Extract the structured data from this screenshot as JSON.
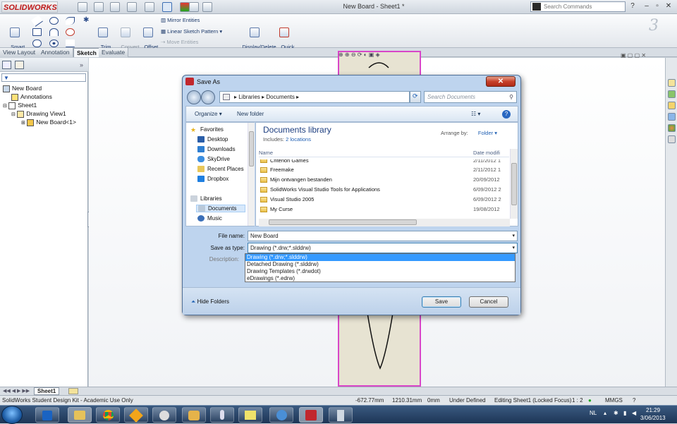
{
  "app": {
    "logo": "SOLIDWORKS",
    "document_title": "New Board - Sheet1 *",
    "search_placeholder": "Search Commands",
    "help": "?"
  },
  "commands": {
    "smart_dimension": "Smart\nDimension",
    "trim": "Trim\nEntities",
    "convert": "Convert\nEntities",
    "offset": "Offset\nEntities",
    "mirror": "Mirror Entities",
    "linear_pattern": "Linear Sketch Pattern",
    "move": "Move Entities",
    "display_delete": "Display/Delete\nRelations",
    "quick_snaps": "Quick\nSnaps"
  },
  "tabs": [
    "View Layout",
    "Annotation",
    "Sketch",
    "Evaluate"
  ],
  "active_tab": "Sketch",
  "tree": {
    "root": "New Board",
    "annotations": "Annotations",
    "sheet": "Sheet1",
    "drawing_view": "Drawing View1",
    "component": "New Board<1>"
  },
  "sheet_tab": "Sheet1",
  "status": {
    "product": "SolidWorks Student Design Kit - Academic Use Only",
    "x": "-672.77mm",
    "y": "1210.31mm",
    "z": "0mm",
    "state": "Under Defined",
    "editing": "Editing Sheet1 (Locked Focus)",
    "scale": "1 : 2",
    "units": "MMGS"
  },
  "dialog": {
    "title": "Save As",
    "address": [
      "Libraries",
      "Documents"
    ],
    "search_placeholder": "Search Documents",
    "organize": "Organize",
    "new_folder": "New folder",
    "nav": {
      "favorites": "Favorites",
      "items": [
        "Desktop",
        "Downloads",
        "SkyDrive",
        "Recent Places",
        "Dropbox"
      ],
      "libraries": "Libraries",
      "lib_items": [
        "Documents",
        "Music"
      ]
    },
    "library_title": "Documents library",
    "includes_label": "Includes:",
    "includes_link": "2 locations",
    "arrange_label": "Arrange by:",
    "arrange_value": "Folder",
    "col_name": "Name",
    "col_date": "Date modifi",
    "files": [
      {
        "name": "Criterion Games",
        "date": "2/11/2012 1"
      },
      {
        "name": "Freemake",
        "date": "2/11/2012 1"
      },
      {
        "name": "Mijn ontvangen bestanden",
        "date": "20/09/2012"
      },
      {
        "name": "SolidWorks Visual Studio Tools for Applications",
        "date": "6/09/2012 2"
      },
      {
        "name": "Visual Studio 2005",
        "date": "6/09/2012 2"
      },
      {
        "name": "My Curse",
        "date": "19/08/2012"
      }
    ],
    "file_name_label": "File name:",
    "file_name_value": "New Board",
    "save_type_label": "Save as type:",
    "save_type_value": "Drawing (*.drw;*.slddrw)",
    "type_options": [
      "Drawing (*.drw;*.slddrw)",
      "Detached Drawing (*.slddrw)",
      "Drawing Templates (*.drwdot)",
      "eDrawings (*.edrw)"
    ],
    "description_label": "Description:",
    "hide_folders": "Hide Folders",
    "save": "Save",
    "cancel": "Cancel"
  },
  "tray": {
    "lang": "NL",
    "time": "21:29",
    "date": "3/06/2013"
  }
}
